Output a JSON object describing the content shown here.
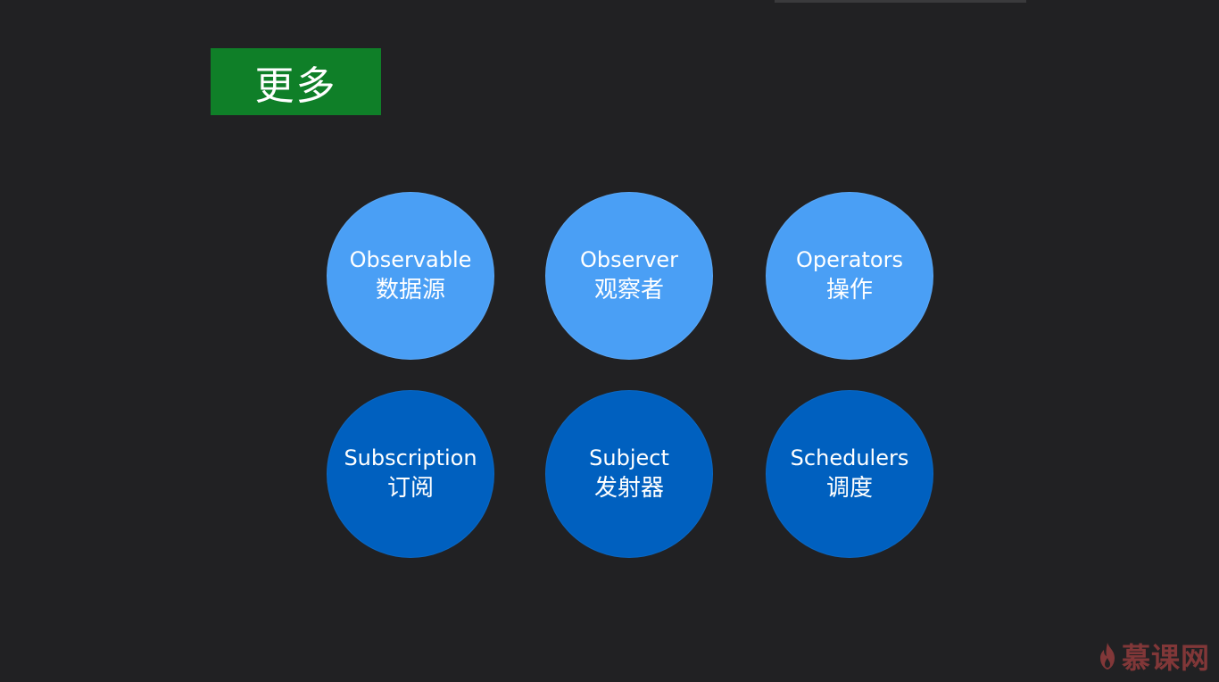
{
  "slide": {
    "title": "更多",
    "circles": [
      {
        "en": "Observable",
        "zh": "数据源",
        "style": "light"
      },
      {
        "en": "Observer",
        "zh": "观察者",
        "style": "light"
      },
      {
        "en": "Operators",
        "zh": "操作",
        "style": "light"
      },
      {
        "en": "Subscription",
        "zh": "订阅",
        "style": "dark"
      },
      {
        "en": "Subject",
        "zh": "发射器",
        "style": "dark"
      },
      {
        "en": "Schedulers",
        "zh": "调度",
        "style": "dark"
      }
    ]
  },
  "watermark": {
    "text": "慕课网",
    "icon": "flame-icon"
  },
  "colors": {
    "background": "#212123",
    "title_box": "#0f7f28",
    "circle_light": "#4a9ff5",
    "circle_dark": "#0060bf",
    "watermark": "#d04a4a"
  }
}
